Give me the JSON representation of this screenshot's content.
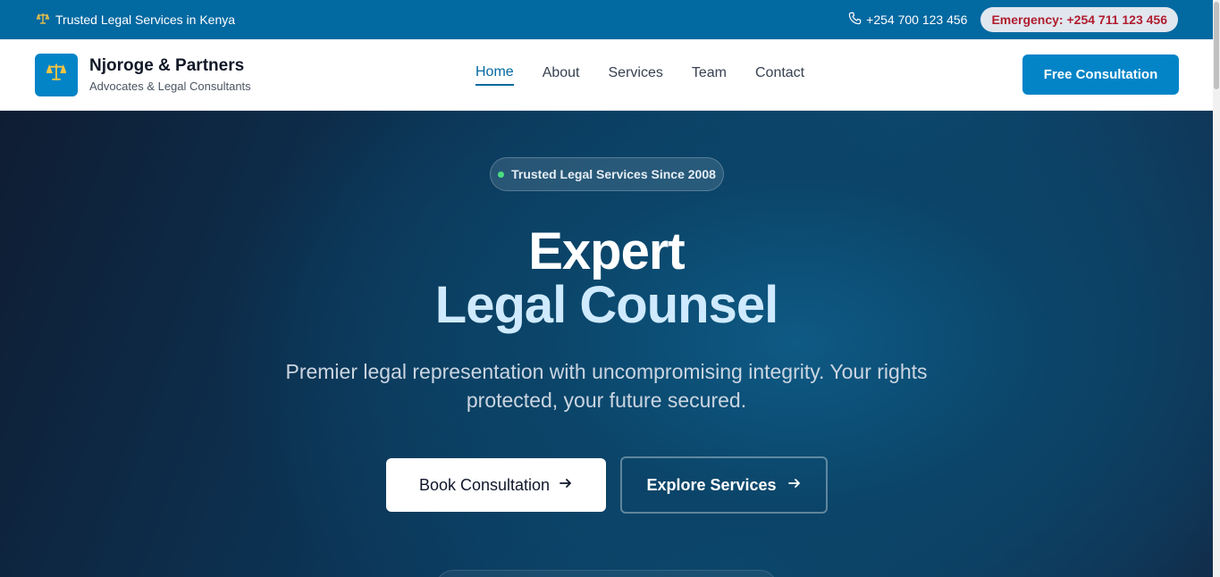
{
  "topbar": {
    "tagline": "Trusted Legal Services in Kenya",
    "tagline_icon": "scales-icon",
    "phone": "+254 700 123 456",
    "emergency": "Emergency: +254 711 123 456"
  },
  "header": {
    "brand_name": "Njoroge & Partners",
    "brand_sub": "Advocates & Legal Consultants",
    "nav": [
      "Home",
      "About",
      "Services",
      "Team",
      "Contact"
    ],
    "active_nav": "Home",
    "cta": "Free Consultation"
  },
  "hero": {
    "badge": "Trusted Legal Services Since 2008",
    "title_line1": "Expert",
    "title_line2": "Legal Counsel",
    "subtitle_line1": "Premier legal representation with uncompromising integrity. Your rights",
    "subtitle_line2": "protected, your future secured.",
    "primary_button": "Book Consultation",
    "secondary_button": "Explore Services"
  },
  "colors": {
    "topbar": "#0369a1",
    "accent": "#0284c7",
    "emergency_text": "#b11d2e",
    "hero_dark": "#0f1d33",
    "title_highlight": "#cfeafe"
  }
}
